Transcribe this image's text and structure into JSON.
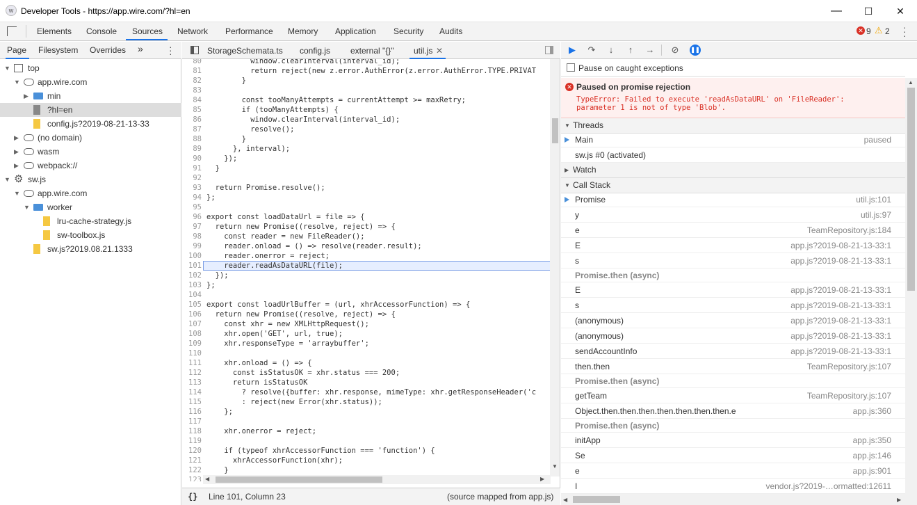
{
  "window": {
    "title": "Developer Tools - https://app.wire.com/?hl=en",
    "logo": "wire-icon",
    "minimize": "—",
    "maximize": "☐",
    "close": "✕"
  },
  "toolbar": {
    "tabs": [
      "Elements",
      "Console",
      "Sources",
      "Network",
      "Performance",
      "Memory",
      "Application",
      "Security",
      "Audits"
    ],
    "active_tab": "Sources",
    "error_count": "9",
    "warning_count": "2"
  },
  "navigator": {
    "tabs": [
      "Page",
      "Filesystem",
      "Overrides"
    ],
    "more": "»",
    "tree": [
      {
        "label": "top",
        "type": "frame",
        "depth": 0,
        "expanded": true
      },
      {
        "label": "app.wire.com",
        "type": "cloud",
        "depth": 1,
        "expanded": true
      },
      {
        "label": "min",
        "type": "folder",
        "depth": 2,
        "expanded": false
      },
      {
        "label": "?hl=en",
        "type": "file-gray",
        "depth": 2,
        "selected": true
      },
      {
        "label": "config.js?2019-08-21-13-33",
        "type": "file",
        "depth": 2
      },
      {
        "label": "(no domain)",
        "type": "cloud",
        "depth": 1,
        "expanded": false
      },
      {
        "label": "wasm",
        "type": "cloud",
        "depth": 1,
        "expanded": false
      },
      {
        "label": "webpack://",
        "type": "cloud",
        "depth": 1,
        "expanded": false
      },
      {
        "label": "sw.js",
        "type": "gear",
        "depth": 0,
        "expanded": true
      },
      {
        "label": "app.wire.com",
        "type": "cloud",
        "depth": 1,
        "expanded": true
      },
      {
        "label": "worker",
        "type": "folder",
        "depth": 2,
        "expanded": true
      },
      {
        "label": "lru-cache-strategy.js",
        "type": "file",
        "depth": 3
      },
      {
        "label": "sw-toolbox.js",
        "type": "file",
        "depth": 3
      },
      {
        "label": "sw.js?2019.08.21.1333",
        "type": "file",
        "depth": 2
      }
    ]
  },
  "editor": {
    "tabs": [
      "StorageSchemata.ts",
      "config.js",
      "external \"{}\"",
      "util.js"
    ],
    "active_tab": "util.js",
    "lines": [
      {
        "n": "80",
        "t": "          window.clearInterval(interval_id);"
      },
      {
        "n": "81",
        "t": "          return reject(new z.error.AuthError(z.error.AuthError.TYPE.PRIVAT"
      },
      {
        "n": "82",
        "t": "        }"
      },
      {
        "n": "83",
        "t": ""
      },
      {
        "n": "84",
        "t": "        const tooManyAttempts = currentAttempt >= maxRetry;"
      },
      {
        "n": "85",
        "t": "        if (tooManyAttempts) {"
      },
      {
        "n": "86",
        "t": "          window.clearInterval(interval_id);"
      },
      {
        "n": "87",
        "t": "          resolve();"
      },
      {
        "n": "88",
        "t": "        }"
      },
      {
        "n": "89",
        "t": "      }, interval);"
      },
      {
        "n": "90",
        "t": "    });"
      },
      {
        "n": "91",
        "t": "  }"
      },
      {
        "n": "92",
        "t": ""
      },
      {
        "n": "93",
        "t": "  return Promise.resolve();"
      },
      {
        "n": "94",
        "t": "};"
      },
      {
        "n": "95",
        "t": ""
      },
      {
        "n": "96",
        "t": "export const loadDataUrl = file => {"
      },
      {
        "n": "97",
        "t": "  return new Promise((resolve, reject) => {"
      },
      {
        "n": "98",
        "t": "    const reader = new FileReader();"
      },
      {
        "n": "99",
        "t": "    reader.onload = () => resolve(reader.result);"
      },
      {
        "n": "100",
        "t": "    reader.onerror = reject;"
      },
      {
        "n": "101",
        "t": "    reader.readAsDataURL(file);"
      },
      {
        "n": "102",
        "t": "  });"
      },
      {
        "n": "103",
        "t": "};"
      },
      {
        "n": "104",
        "t": ""
      },
      {
        "n": "105",
        "t": "export const loadUrlBuffer = (url, xhrAccessorFunction) => {"
      },
      {
        "n": "106",
        "t": "  return new Promise((resolve, reject) => {"
      },
      {
        "n": "107",
        "t": "    const xhr = new XMLHttpRequest();"
      },
      {
        "n": "108",
        "t": "    xhr.open('GET', url, true);"
      },
      {
        "n": "109",
        "t": "    xhr.responseType = 'arraybuffer';"
      },
      {
        "n": "110",
        "t": ""
      },
      {
        "n": "111",
        "t": "    xhr.onload = () => {"
      },
      {
        "n": "112",
        "t": "      const isStatusOK = xhr.status === 200;"
      },
      {
        "n": "113",
        "t": "      return isStatusOK"
      },
      {
        "n": "114",
        "t": "        ? resolve({buffer: xhr.response, mimeType: xhr.getResponseHeader('c"
      },
      {
        "n": "115",
        "t": "        : reject(new Error(xhr.status));"
      },
      {
        "n": "116",
        "t": "    };"
      },
      {
        "n": "117",
        "t": ""
      },
      {
        "n": "118",
        "t": "    xhr.onerror = reject;"
      },
      {
        "n": "119",
        "t": ""
      },
      {
        "n": "120",
        "t": "    if (typeof xhrAccessorFunction === 'function') {"
      },
      {
        "n": "121",
        "t": "      xhrAccessorFunction(xhr);"
      },
      {
        "n": "122",
        "t": "    }"
      },
      {
        "n": "123",
        "t": "    xhr.send();"
      }
    ],
    "highlight_line": "101",
    "status": {
      "format_icon": "{}",
      "position": "Line 101, Column 23",
      "source": "(source mapped from app.js)"
    }
  },
  "debugger": {
    "pause_checkbox_label": "Pause on caught exceptions",
    "error_title": "Paused on promise rejection",
    "error_message": "TypeError: Failed to execute 'readAsDataURL' on 'FileReader':\nparameter 1 is not of type 'Blob'.",
    "threads_label": "Threads",
    "threads": [
      {
        "name": "Main",
        "status": "paused",
        "current": true
      },
      {
        "name": "sw.js #0 (activated)",
        "status": ""
      }
    ],
    "watch_label": "Watch",
    "callstack_label": "Call Stack",
    "callstack": [
      {
        "name": "Promise",
        "loc": "util.js:101",
        "current": true
      },
      {
        "name": "y",
        "loc": "util.js:97"
      },
      {
        "name": "e",
        "loc": "TeamRepository.js:184"
      },
      {
        "name": "E",
        "loc": "app.js?2019-08-21-13-33:1"
      },
      {
        "name": "s",
        "loc": "app.js?2019-08-21-13-33:1"
      },
      {
        "async": "Promise.then (async)"
      },
      {
        "name": "E",
        "loc": "app.js?2019-08-21-13-33:1"
      },
      {
        "name": "s",
        "loc": "app.js?2019-08-21-13-33:1"
      },
      {
        "name": "(anonymous)",
        "loc": "app.js?2019-08-21-13-33:1"
      },
      {
        "name": "(anonymous)",
        "loc": "app.js?2019-08-21-13-33:1"
      },
      {
        "name": "sendAccountInfo",
        "loc": "app.js?2019-08-21-13-33:1"
      },
      {
        "name": "then.then",
        "loc": "TeamRepository.js:107"
      },
      {
        "async": "Promise.then (async)"
      },
      {
        "name": "getTeam",
        "loc": "TeamRepository.js:107"
      },
      {
        "name": "Object.then.then.then.then.then.then.then.e",
        "loc": "app.js:360"
      },
      {
        "async": "Promise.then (async)"
      },
      {
        "name": "initApp",
        "loc": "app.js:350"
      },
      {
        "name": "Se",
        "loc": "app.js:146"
      },
      {
        "name": "e",
        "loc": "app.js:901"
      },
      {
        "name": "I",
        "loc": "vendor.js?2019-…ormatted:12611"
      }
    ]
  },
  "colors": {
    "accent": "#1a73e8",
    "error_red": "#d93025",
    "error_bg": "#fef0ef",
    "resume_blue": "#1a73e8"
  }
}
